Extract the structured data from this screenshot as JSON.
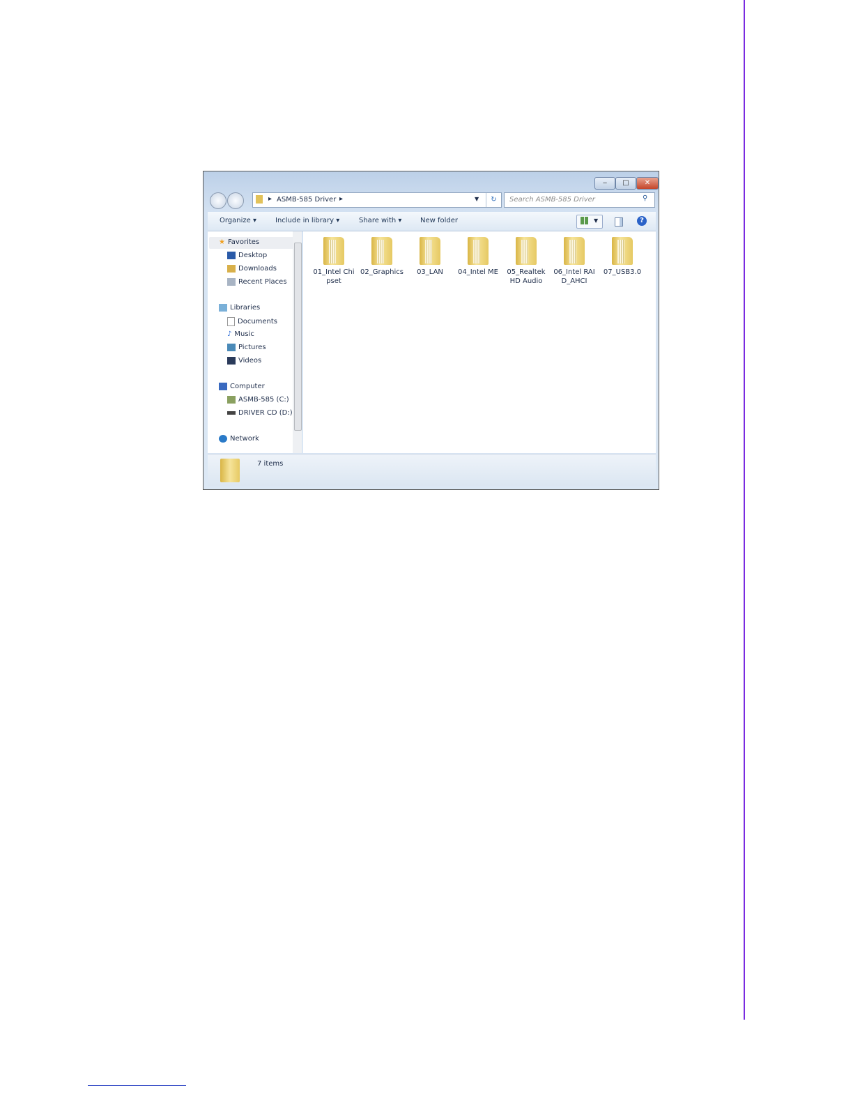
{
  "window": {
    "minimize": "‒",
    "maximize": "□",
    "close": "✕",
    "address": {
      "path": "ASMB-585 Driver"
    },
    "search": {
      "placeholder": "Search ASMB-585 Driver"
    },
    "toolbar": {
      "organize": "Organize ▾",
      "include": "Include in library ▾",
      "share": "Share with ▾",
      "new_folder": "New folder"
    },
    "nav": {
      "favorites": {
        "label": "Favorites",
        "items": [
          "Desktop",
          "Downloads",
          "Recent Places"
        ]
      },
      "libraries": {
        "label": "Libraries",
        "items": [
          "Documents",
          "Music",
          "Pictures",
          "Videos"
        ]
      },
      "computer": {
        "label": "Computer",
        "items": [
          "ASMB-585 (C:)",
          "DRIVER CD (D:)"
        ]
      },
      "network": {
        "label": "Network"
      }
    },
    "folders": [
      "01_Intel Chipset",
      "02_Graphics",
      "03_LAN",
      "04_Intel ME",
      "05_Realtek HD Audio",
      "06_Intel RAID_AHCI",
      "07_USB3.0"
    ],
    "status": "7 items"
  }
}
